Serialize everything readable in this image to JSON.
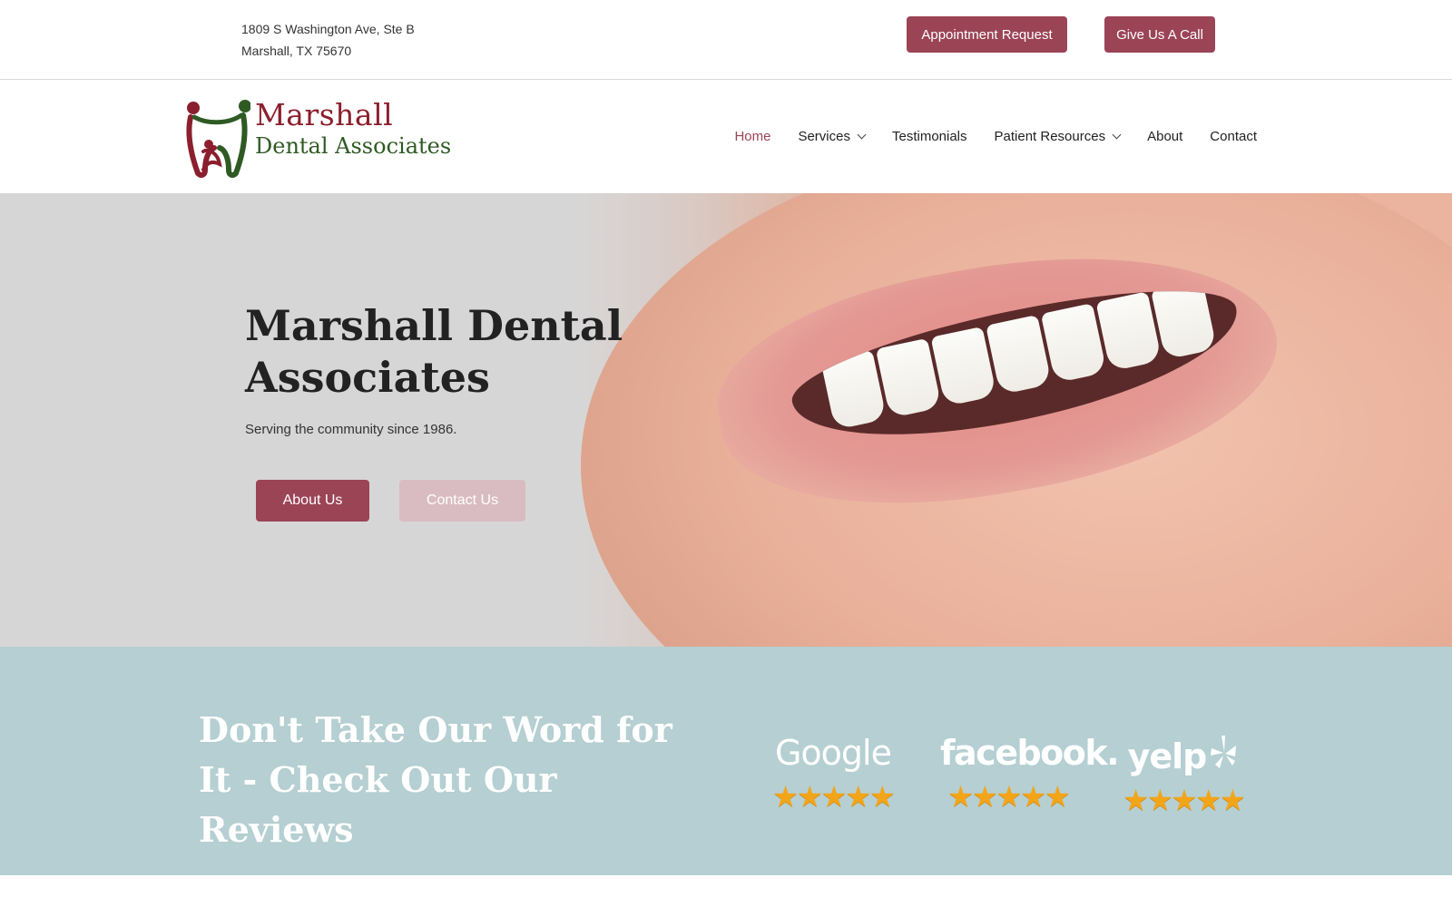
{
  "topbar": {
    "address_line1": "1809 S Washington Ave, Ste B",
    "address_line2": "Marshall, TX 75670",
    "appointment_label": "Appointment Request",
    "call_label": "Give Us A Call"
  },
  "logo": {
    "line1": "Marshall",
    "line2": "Dental Associates",
    "color_primary": "#8b1f2d",
    "color_secondary": "#2f5a24"
  },
  "nav": {
    "items": [
      {
        "label": "Home",
        "active": true,
        "dropdown": false
      },
      {
        "label": "Services",
        "active": false,
        "dropdown": true
      },
      {
        "label": "Testimonials",
        "active": false,
        "dropdown": false
      },
      {
        "label": "Patient Resources",
        "active": false,
        "dropdown": true
      },
      {
        "label": "About",
        "active": false,
        "dropdown": false
      },
      {
        "label": "Contact",
        "active": false,
        "dropdown": false
      }
    ]
  },
  "hero": {
    "title": "Marshall Dental Associates",
    "subtitle": "Serving the community since 1986.",
    "about_label": "About Us",
    "contact_label": "Contact Us"
  },
  "reviews": {
    "title": "Don't Take Our Word for It - Check Out Our Reviews",
    "platforms": [
      {
        "name": "Google",
        "stars": "★★★★★"
      },
      {
        "name": "facebook.",
        "stars": "★★★★★"
      },
      {
        "name": "yelp",
        "stars": "★★★★★"
      }
    ]
  },
  "colors": {
    "accent": "#9b4456",
    "accent_light": "#d9bcc1",
    "reviews_bg": "#b5cfd2",
    "star": "#f3a51a"
  }
}
